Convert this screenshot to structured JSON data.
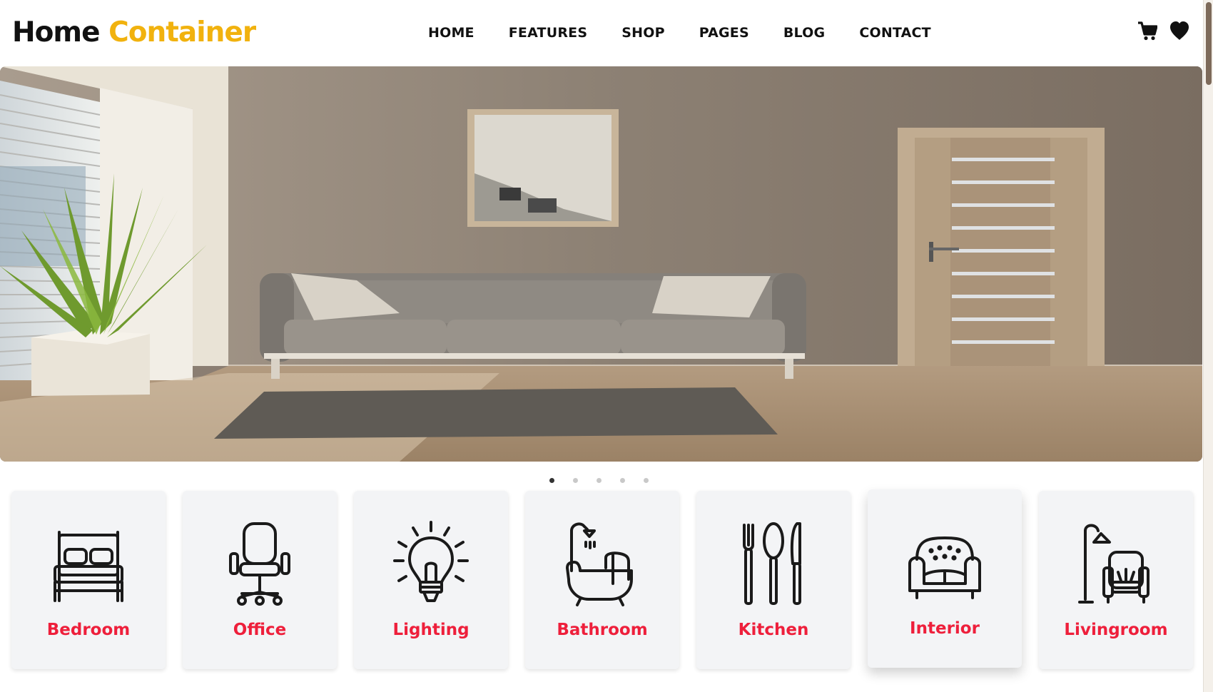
{
  "brand": {
    "word1": "Home",
    "word2": "Container",
    "accent_color": "#f1b20e"
  },
  "nav": [
    {
      "label": "HOME"
    },
    {
      "label": "FEATURES"
    },
    {
      "label": "SHOP"
    },
    {
      "label": "PAGES"
    },
    {
      "label": "BLOG"
    },
    {
      "label": "CONTACT"
    }
  ],
  "header_icons": [
    "cart-icon",
    "heart-icon"
  ],
  "carousel": {
    "slide_count": 5,
    "active_index": 0
  },
  "categories": [
    {
      "label": "Bedroom",
      "icon": "bed-icon"
    },
    {
      "label": "Office",
      "icon": "office-chair-icon"
    },
    {
      "label": "Lighting",
      "icon": "light-bulb-icon"
    },
    {
      "label": "Bathroom",
      "icon": "bathtub-icon"
    },
    {
      "label": "Kitchen",
      "icon": "cutlery-icon"
    },
    {
      "label": "Interior",
      "icon": "sofa-icon"
    },
    {
      "label": "Livingroom",
      "icon": "floor-lamp-armchair-icon"
    }
  ],
  "colors": {
    "category_label": "#ee1f3b",
    "card_bg": "#f3f4f6"
  }
}
